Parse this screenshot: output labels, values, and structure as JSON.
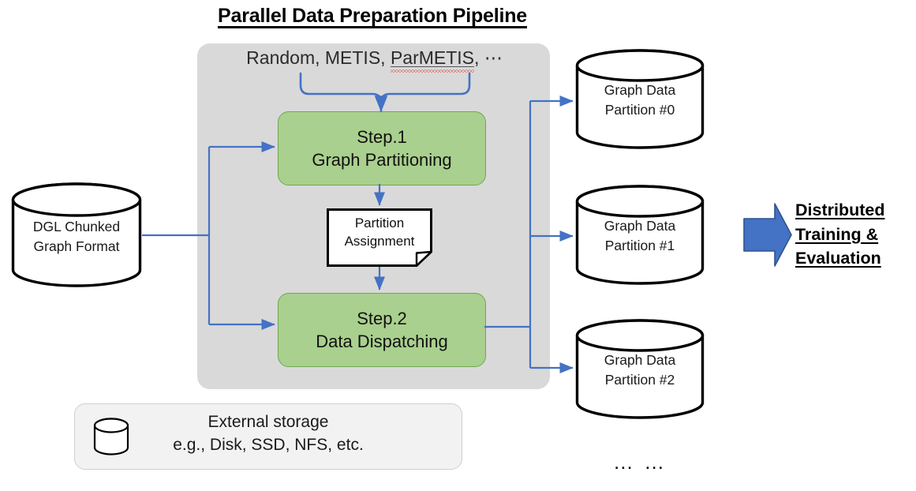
{
  "title": "Parallel Data Preparation Pipeline",
  "pipeline": {
    "algorithms": {
      "prefix": "Random, METIS, ",
      "spellchecked": "ParMETIS",
      "suffix": ", ",
      "ellipsis": "⋯"
    },
    "step1": {
      "line1": "Step.1",
      "line2": "Graph Partitioning"
    },
    "step2": {
      "line1": "Step.2",
      "line2": "Data Dispatching"
    },
    "artifact": {
      "line1": "Partition",
      "line2": "Assignment"
    }
  },
  "source": {
    "line1": "DGL Chunked",
    "line2": "Graph Format"
  },
  "partitions": [
    {
      "line1": "Graph Data",
      "line2": "Partition #0"
    },
    {
      "line1": "Graph Data",
      "line2": "Partition #1"
    },
    {
      "line1": "Graph Data",
      "line2": "Partition #2"
    }
  ],
  "partitions_more": "… …",
  "storage": {
    "line1": "External storage",
    "line2": "e.g., Disk, SSD, NFS, etc."
  },
  "conclusion": {
    "line1": "Distributed",
    "line2": "Training &",
    "line3": "Evaluation"
  },
  "colors": {
    "panel_gray": "#D9D9D9",
    "step_green": "#A9D08E",
    "step_green_border": "#70A84F",
    "connector_blue": "#4472C4",
    "big_arrow_blue": "#4472C4",
    "big_arrow_border": "#2F528F",
    "storage_bg": "#F2F2F2",
    "text_black": "#000000",
    "spellcheck_red": "#E03A2F"
  }
}
